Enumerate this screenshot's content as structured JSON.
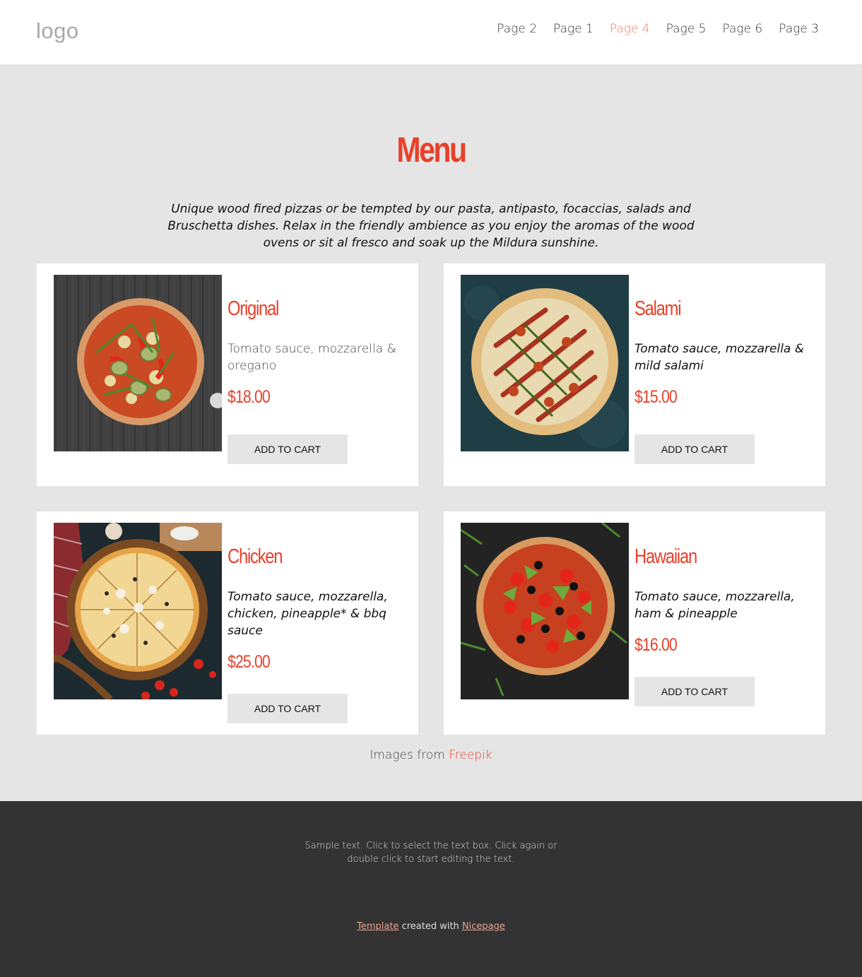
{
  "header": {
    "logo": "logo",
    "nav": [
      "Page 2",
      "Page 1",
      "Page 4",
      "Page 5",
      "Page 6",
      "Page 3"
    ],
    "active_nav": "Page 4"
  },
  "main": {
    "title": "Menu",
    "intro": "Unique wood fired pizzas or be tempted by our pasta, antipasto, focaccias, salads and Bruschetta dishes. Relax in the friendly ambience as you enjoy the aromas of the wood ovens or sit al fresco and soak up the Mildura sunshine.",
    "items": [
      {
        "name": "Original",
        "description": "Tomato sauce, mozzarella & oregano",
        "price": "$18.00",
        "button": "ADD TO CART"
      },
      {
        "name": "Salami",
        "description": "Tomato sauce, mozzarella & mild salami",
        "price": "$15.00",
        "button": "ADD TO CART"
      },
      {
        "name": "Chicken",
        "description": "Tomato sauce, mozzarella, chicken, pineapple* & bbq sauce",
        "price": "$25.00",
        "button": "ADD TO CART"
      },
      {
        "name": "Hawaiian",
        "description": "Tomato sauce, mozzarella, ham & pineapple",
        "price": "$16.00",
        "button": "ADD TO CART"
      }
    ],
    "credit_prefix": "Images from",
    "credit_link": "Freepik"
  },
  "footer": {
    "text": "Sample text. Click to select the text box. Click again or double click to start editing the text.",
    "credit_link1": "Template",
    "credit_middle": "created with",
    "credit_link2": "Nicepage"
  },
  "colors": {
    "accent": "#e8412a",
    "nav_active": "#e87b62",
    "background": "#e5e5e5",
    "footer_bg": "#333333"
  }
}
